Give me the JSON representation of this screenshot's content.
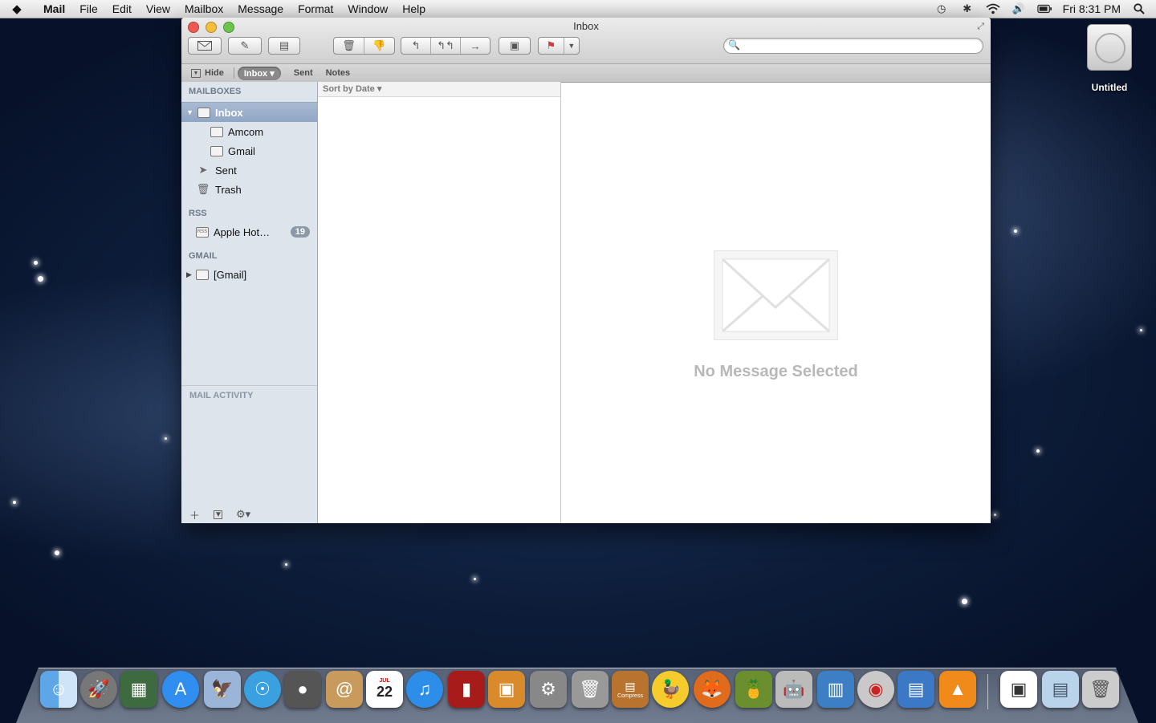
{
  "menubar": {
    "apple": "",
    "items": [
      "Mail",
      "File",
      "Edit",
      "View",
      "Mailbox",
      "Message",
      "Format",
      "Window",
      "Help"
    ],
    "clock": "Fri 8:31 PM"
  },
  "desktop": {
    "drive_label": "Untitled"
  },
  "window": {
    "title": "Inbox",
    "favorites": {
      "hide": "Hide",
      "inbox": "Inbox ▾",
      "sent": "Sent",
      "notes": "Notes"
    },
    "sidebar": {
      "mailboxes_header": "MAILBOXES",
      "inbox": "Inbox",
      "accounts": [
        "Amcom",
        "Gmail"
      ],
      "sent": "Sent",
      "trash": "Trash",
      "rss_header": "RSS",
      "rss_feed": "Apple Hot…",
      "rss_count": "19",
      "gmail_header": "GMAIL",
      "gmail_folder": "[Gmail]",
      "activity": "MAIL ACTIVITY"
    },
    "sort_label": "Sort by Date ▾",
    "empty_message": "No Message Selected"
  },
  "dock": {
    "apps": [
      "Finder",
      "Launchpad",
      "Mission Control",
      "App Store",
      "Preview",
      "Safari",
      "FaceTime",
      "Contacts",
      "Calendar",
      "iTunes",
      "Photo Booth",
      "iPhoto",
      "System Preferences",
      "Archive Utility",
      "Compress",
      "Cyberduck",
      "Firefox",
      "Cocktail",
      "Automator",
      "Boot Camp",
      "Disk Utility",
      "Preferences",
      "VLC"
    ],
    "calendar_day": "22",
    "calendar_month": "JUL",
    "compress_label": "Compress"
  }
}
